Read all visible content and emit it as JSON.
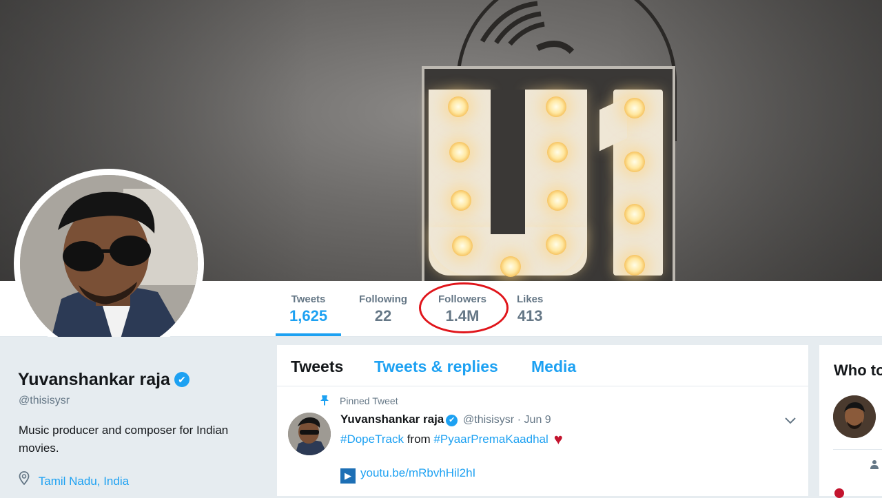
{
  "profile": {
    "name": "Yuvanshankar raja",
    "handle": "@thisisysr",
    "bio": "Music producer and composer for Indian movies.",
    "location": "Tamil Nadu, India",
    "verified_icon": "✔"
  },
  "nav": {
    "stats": [
      {
        "label": "Tweets",
        "value": "1,625"
      },
      {
        "label": "Following",
        "value": "22"
      },
      {
        "label": "Followers",
        "value": "1.4M"
      },
      {
        "label": "Likes",
        "value": "413"
      }
    ],
    "active": "Tweets",
    "highlighted": "Followers"
  },
  "timeline": {
    "tabs": [
      "Tweets",
      "Tweets & replies",
      "Media"
    ],
    "pinned_label": "Pinned Tweet",
    "tweet": {
      "name": "Yuvanshankar raja",
      "handle": "@thisisysr",
      "date": "· Jun 9",
      "hashtag1": "#DopeTrack",
      "text_mid": "from",
      "hashtag2": "#PyaarPremaKaadhal",
      "heart": "♥",
      "link": "youtu.be/mRbvhHil2hI"
    }
  },
  "sidebar": {
    "who_to_follow_title": "Who to"
  },
  "cover": {
    "sign_text": "U1"
  },
  "colors": {
    "accent": "#1da1f2",
    "highlight_circle": "#e0151b",
    "text_secondary": "#657786"
  }
}
